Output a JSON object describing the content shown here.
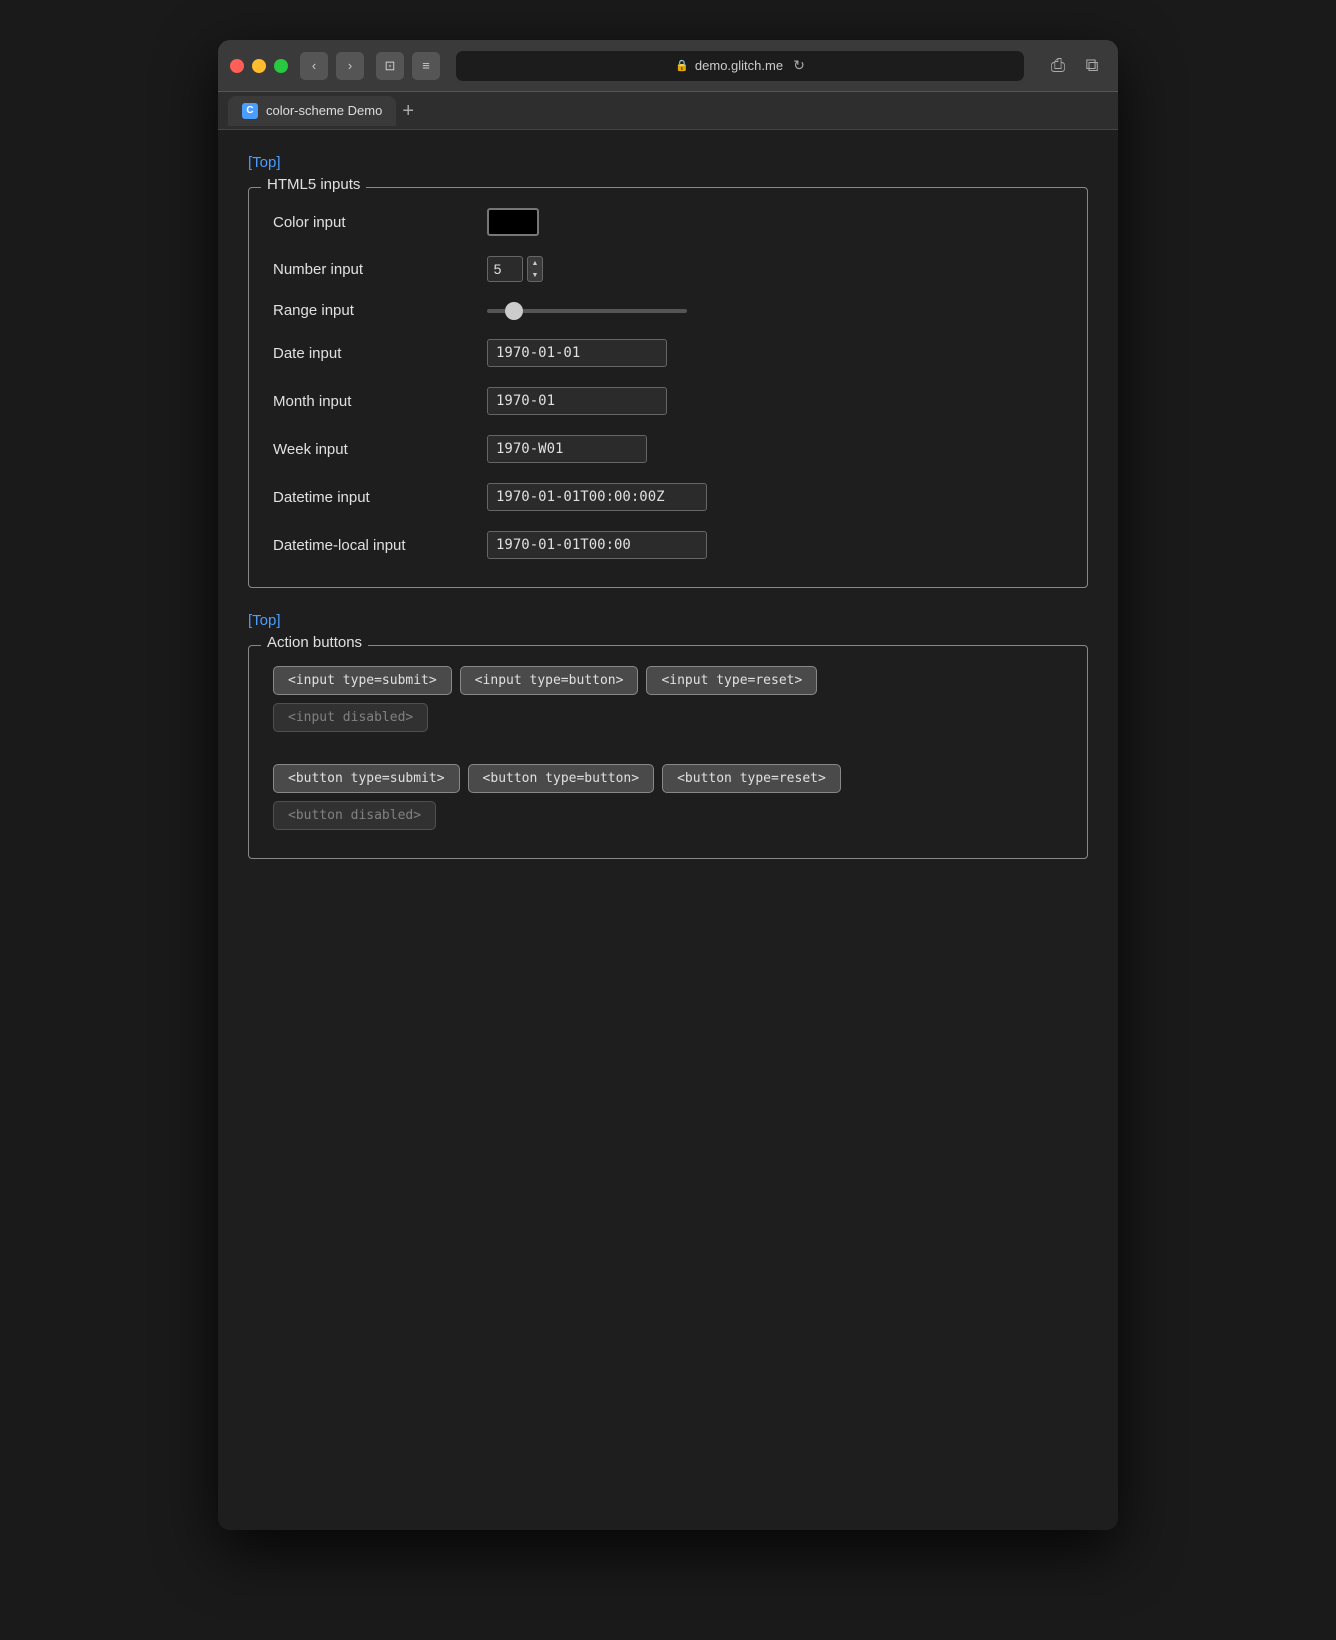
{
  "browser": {
    "url": "demo.glitch.me",
    "tab_title": "color-scheme Demo",
    "tab_favicon": "C"
  },
  "nav": {
    "back_label": "‹",
    "forward_label": "›",
    "sidebar_label": "⊡",
    "menu_label": "≡",
    "reload_label": "↻",
    "share_label": "⎙",
    "tabs_label": "⧉",
    "new_tab_label": "+"
  },
  "page": {
    "top_link": "[Top]",
    "top_link2": "[Top]"
  },
  "html5_section": {
    "legend": "HTML5 inputs",
    "color_label": "Color input",
    "number_label": "Number input",
    "number_value": "5",
    "range_label": "Range input",
    "date_label": "Date input",
    "date_value": "1970-01-01",
    "month_label": "Month input",
    "month_value": "1970-01",
    "week_label": "Week input",
    "week_value": "1970-W01",
    "datetime_label": "Datetime input",
    "datetime_value": "1970-01-01T00:00:00Z",
    "datetime_local_label": "Datetime-local input",
    "datetime_local_value": "1970-01-01T00:00"
  },
  "action_section": {
    "legend": "Action buttons",
    "input_submit": "<input type=submit>",
    "input_button": "<input type=button>",
    "input_reset": "<input type=reset>",
    "input_disabled": "<input disabled>",
    "button_submit": "<button type=submit>",
    "button_button": "<button type=button>",
    "button_reset": "<button type=reset>",
    "button_disabled": "<button disabled>"
  }
}
